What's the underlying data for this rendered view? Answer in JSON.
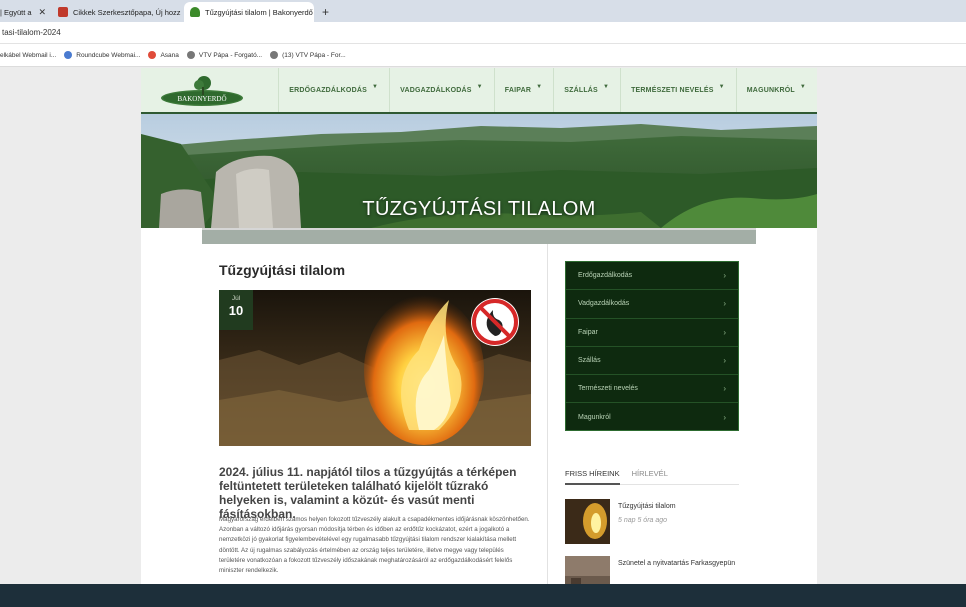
{
  "browser": {
    "tabs": [
      {
        "label": "| Együtt a"
      },
      {
        "label": "Cikkek Szerkesztőpapa, Új hozz"
      },
      {
        "label": "Tűzgyújtási tilalom | Bakonyerdő"
      }
    ],
    "new_tab_label": "+",
    "address": "tasi-tilalom-2024",
    "bookmarks": [
      {
        "label": "elkábel Webmail i..."
      },
      {
        "label": "Roundcube Webmai..."
      },
      {
        "label": "Asana"
      },
      {
        "label": "VTV Pápa - Forgató..."
      },
      {
        "label": "(13) VTV Pápa - For..."
      }
    ]
  },
  "site": {
    "logo_text": "BAKONYERDŐ",
    "nav": [
      {
        "label": "ERDŐGAZDÁLKODÁS"
      },
      {
        "label": "VADGAZDÁLKODÁS"
      },
      {
        "label": "FAIPAR"
      },
      {
        "label": "SZÁLLÁS"
      },
      {
        "label": "TERMÉSZETI NEVELÉS"
      },
      {
        "label": "MAGUNKRÓL"
      }
    ],
    "hero_title": "TŰZGYÚJTÁSI TILALOM"
  },
  "article": {
    "title": "Tűzgyújtási tilalom",
    "date_month": "Júl",
    "date_day": "10",
    "lead": "2024. július 11. napjától tilos a tűzgyújtás a térképen feltüntetett területeken található kijelölt tűzrakó helyeken is, valamint a közút- és vasút menti fásításokban.",
    "body": "Magyarország erdeiben számos helyen fokozott tűzveszély alakult a csapadékmentes időjárásnak köszönhetően. Azonban a változó időjárás gyorsan módosítja térben és időben az erdőtűz kockázatot, ezért a jogalkotó a nemzetközi jó gyakorlat figyelembevételével egy rugalmasabb tűzgyújtási tilalom rendszer kialakítása mellett döntött. Az új rugalmas szabályozás értelmében az ország teljes területére, illetve megye vagy település területére vonatkozóan a fokozott tűzveszély időszakának meghatározásáról az erdőgazdálkodásért felelős miniszter rendelkezik."
  },
  "sidebar": {
    "menu": [
      {
        "label": "Erdőgazdálkodás"
      },
      {
        "label": "Vadgazdálkodás"
      },
      {
        "label": "Faipar"
      },
      {
        "label": "Szállás"
      },
      {
        "label": "Természeti nevelés"
      },
      {
        "label": "Magunkról"
      }
    ],
    "news_tabs": [
      {
        "label": "FRISS HÍREINK"
      },
      {
        "label": "HÍRLEVÉL"
      }
    ],
    "news": [
      {
        "title": "Tűzgyújtási tilalom",
        "ago": "5 nap 5 óra ago"
      },
      {
        "title": "Szünetel a nyitvatartás Farkasgyepün",
        "ago": ""
      }
    ]
  },
  "colors": {
    "nav_bg": "#e6f2e5",
    "brand_green": "#2f5a33",
    "sidemenu_bg": "#0e2a0f",
    "taskbar": "#1d2f3a"
  }
}
